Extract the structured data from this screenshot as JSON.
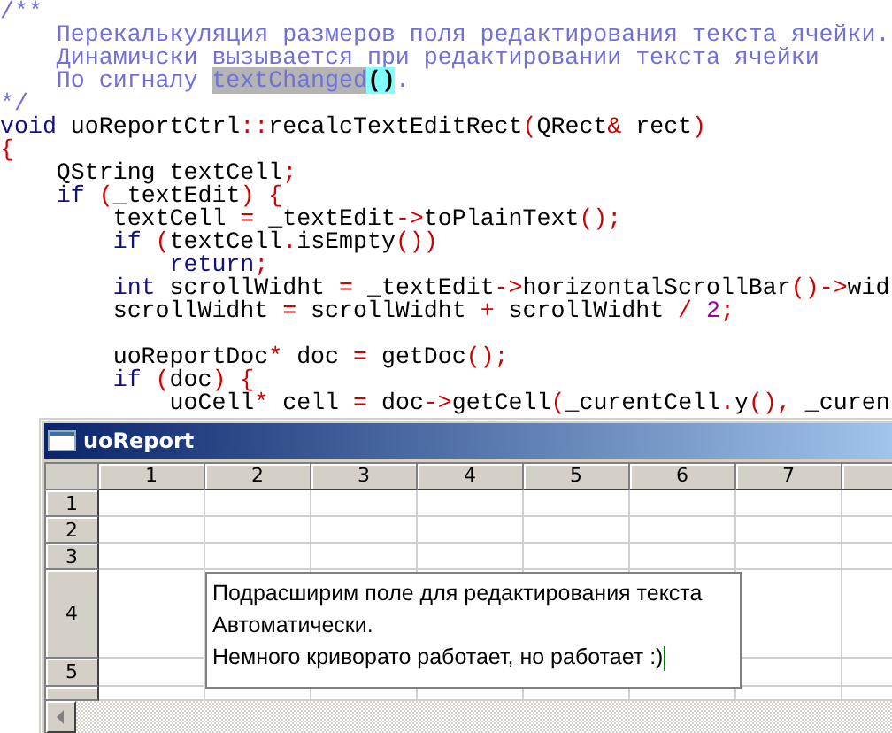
{
  "editor": {
    "lines": [
      {
        "tokens": [
          {
            "text": "/**",
            "kind": "comment"
          }
        ]
      },
      {
        "tokens": [
          {
            "text": "    Перекалькуляция размеров поля редактирования текста ячейки.",
            "kind": "comment"
          }
        ]
      },
      {
        "tokens": [
          {
            "text": "    Динамичски вызывается при редактировании текста ячейки",
            "kind": "comment"
          }
        ]
      },
      {
        "tokens": [
          {
            "text": "    По сигналу ",
            "kind": "comment"
          },
          {
            "text": "textChanged",
            "kind": "selection"
          },
          {
            "text": "()",
            "kind": "bracket"
          },
          {
            "text": ".",
            "kind": "comment"
          }
        ]
      },
      {
        "tokens": [
          {
            "text": "*/",
            "kind": "comment"
          }
        ]
      },
      {
        "tokens": [
          {
            "text": "void",
            "kind": "keyword"
          },
          {
            "text": " uoReportCtrl",
            "kind": "identifier"
          },
          {
            "text": "::",
            "kind": "operator"
          },
          {
            "text": "recalcTextEditRect",
            "kind": "identifier"
          },
          {
            "text": "(",
            "kind": "operator"
          },
          {
            "text": "QRect",
            "kind": "identifier"
          },
          {
            "text": "&",
            "kind": "operator"
          },
          {
            "text": " rect",
            "kind": "identifier"
          },
          {
            "text": ")",
            "kind": "operator"
          }
        ]
      },
      {
        "tokens": [
          {
            "text": "{",
            "kind": "operator"
          }
        ]
      },
      {
        "tokens": [
          {
            "text": "    QString textCell",
            "kind": "identifier"
          },
          {
            "text": ";",
            "kind": "operator"
          }
        ]
      },
      {
        "tokens": [
          {
            "text": "    if",
            "kind": "keyword"
          },
          {
            "text": " (",
            "kind": "operator"
          },
          {
            "text": "_textEdit",
            "kind": "identifier"
          },
          {
            "text": ") {",
            "kind": "operator"
          }
        ]
      },
      {
        "tokens": [
          {
            "text": "        textCell ",
            "kind": "identifier"
          },
          {
            "text": "=",
            "kind": "operator"
          },
          {
            "text": " _textEdit",
            "kind": "identifier"
          },
          {
            "text": "->",
            "kind": "operator"
          },
          {
            "text": "toPlainText",
            "kind": "identifier"
          },
          {
            "text": "();",
            "kind": "operator"
          }
        ]
      },
      {
        "tokens": [
          {
            "text": "        if",
            "kind": "keyword"
          },
          {
            "text": " (",
            "kind": "operator"
          },
          {
            "text": "textCell",
            "kind": "identifier"
          },
          {
            "text": ".",
            "kind": "operator"
          },
          {
            "text": "isEmpty",
            "kind": "identifier"
          },
          {
            "text": "())",
            "kind": "operator"
          }
        ]
      },
      {
        "tokens": [
          {
            "text": "            return",
            "kind": "keyword"
          },
          {
            "text": ";",
            "kind": "operator"
          }
        ]
      },
      {
        "tokens": [
          {
            "text": "        int",
            "kind": "keyword"
          },
          {
            "text": " scrollWidht ",
            "kind": "identifier"
          },
          {
            "text": "=",
            "kind": "operator"
          },
          {
            "text": " _textEdit",
            "kind": "identifier"
          },
          {
            "text": "->",
            "kind": "operator"
          },
          {
            "text": "horizontalScrollBar",
            "kind": "identifier"
          },
          {
            "text": "()->",
            "kind": "operator"
          },
          {
            "text": "wid",
            "kind": "identifier"
          }
        ]
      },
      {
        "tokens": [
          {
            "text": "        scrollWidht ",
            "kind": "identifier"
          },
          {
            "text": "=",
            "kind": "operator"
          },
          {
            "text": " scrollWidht ",
            "kind": "identifier"
          },
          {
            "text": "+",
            "kind": "operator"
          },
          {
            "text": " scrollWidht ",
            "kind": "identifier"
          },
          {
            "text": "/",
            "kind": "operator"
          },
          {
            "text": " 2",
            "kind": "number"
          },
          {
            "text": ";",
            "kind": "operator"
          }
        ]
      },
      {
        "gap_before": true,
        "tokens": [
          {
            "text": "        uoReportDoc",
            "kind": "identifier"
          },
          {
            "text": "*",
            "kind": "operator"
          },
          {
            "text": " doc ",
            "kind": "identifier"
          },
          {
            "text": "=",
            "kind": "operator"
          },
          {
            "text": " getDoc",
            "kind": "identifier"
          },
          {
            "text": "();",
            "kind": "operator"
          }
        ]
      },
      {
        "tokens": [
          {
            "text": "        if",
            "kind": "keyword"
          },
          {
            "text": " (",
            "kind": "operator"
          },
          {
            "text": "doc",
            "kind": "identifier"
          },
          {
            "text": ") {",
            "kind": "operator"
          }
        ]
      },
      {
        "tokens": [
          {
            "text": "            uoCell",
            "kind": "identifier"
          },
          {
            "text": "*",
            "kind": "operator"
          },
          {
            "text": " cell ",
            "kind": "identifier"
          },
          {
            "text": "=",
            "kind": "operator"
          },
          {
            "text": " doc",
            "kind": "identifier"
          },
          {
            "text": "->",
            "kind": "operator"
          },
          {
            "text": "getCell",
            "kind": "identifier"
          },
          {
            "text": "(",
            "kind": "operator"
          },
          {
            "text": "_curentCell",
            "kind": "identifier"
          },
          {
            "text": ".",
            "kind": "operator"
          },
          {
            "text": "y",
            "kind": "identifier"
          },
          {
            "text": "(),",
            "kind": "operator"
          },
          {
            "text": " _curen",
            "kind": "identifier"
          }
        ]
      }
    ]
  },
  "window": {
    "title": "uoReport",
    "columns": [
      "1",
      "2",
      "3",
      "4",
      "5",
      "6",
      "7"
    ],
    "rows": [
      "1",
      "2",
      "3",
      "4",
      "5"
    ],
    "cell_editor": {
      "lines": [
        "Подрасширим поле для редактирования текста",
        "Автоматически.",
        "Немного криворато работает, но работает :)"
      ]
    }
  }
}
